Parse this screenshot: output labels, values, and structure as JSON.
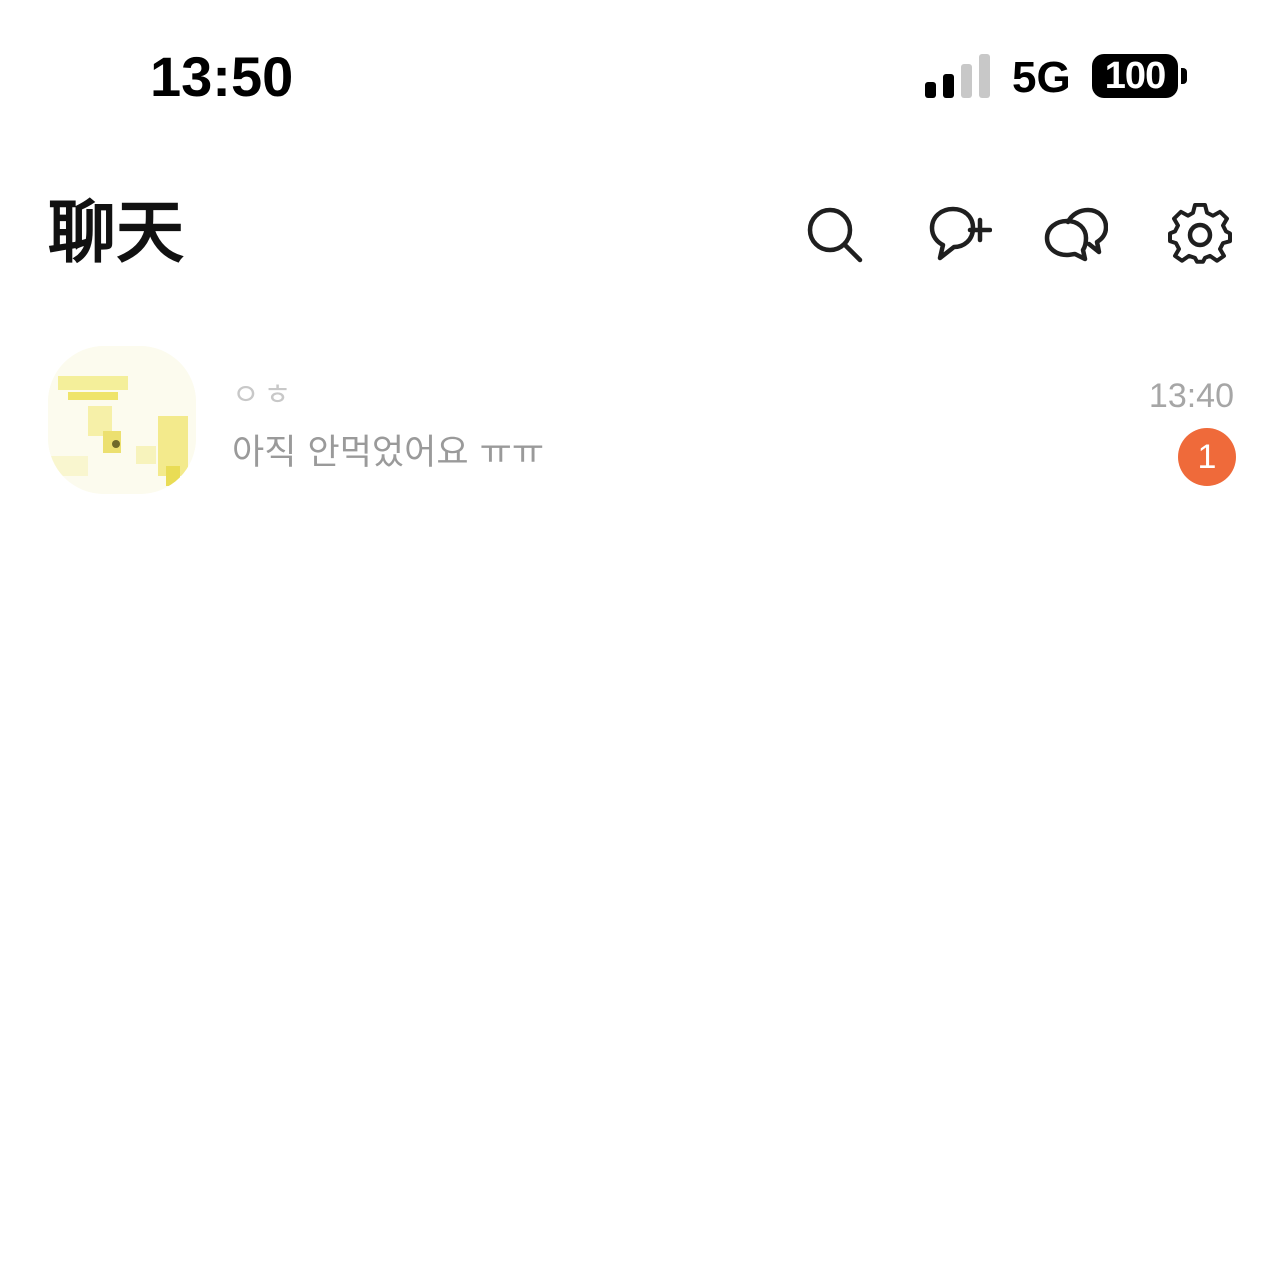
{
  "status_bar": {
    "time": "13:50",
    "network": "5G",
    "battery": "100",
    "signal_level": 0.5,
    "signal_icon": "signal-bars-icon"
  },
  "header": {
    "title": "聊天",
    "actions": [
      {
        "name": "search",
        "icon": "search-icon"
      },
      {
        "name": "new-chat",
        "icon": "chat-plus-icon"
      },
      {
        "name": "open-chat",
        "icon": "chat-bubbles-icon"
      },
      {
        "name": "settings",
        "icon": "gear-icon"
      }
    ]
  },
  "chats": [
    {
      "name": "ㅇㅎ",
      "preview": "아직 안먹었어요 ㅠㅠ",
      "time": "13:40",
      "unread": "1",
      "avatar_icon": "profile-photo-avatar"
    }
  ],
  "colors": {
    "background": "#ffffff",
    "title": "#111111",
    "preview_text": "#9a9a9a",
    "time_text": "#a6a6a6",
    "badge": "#ef6a3a",
    "icon_stroke": "#1f1f1f"
  }
}
